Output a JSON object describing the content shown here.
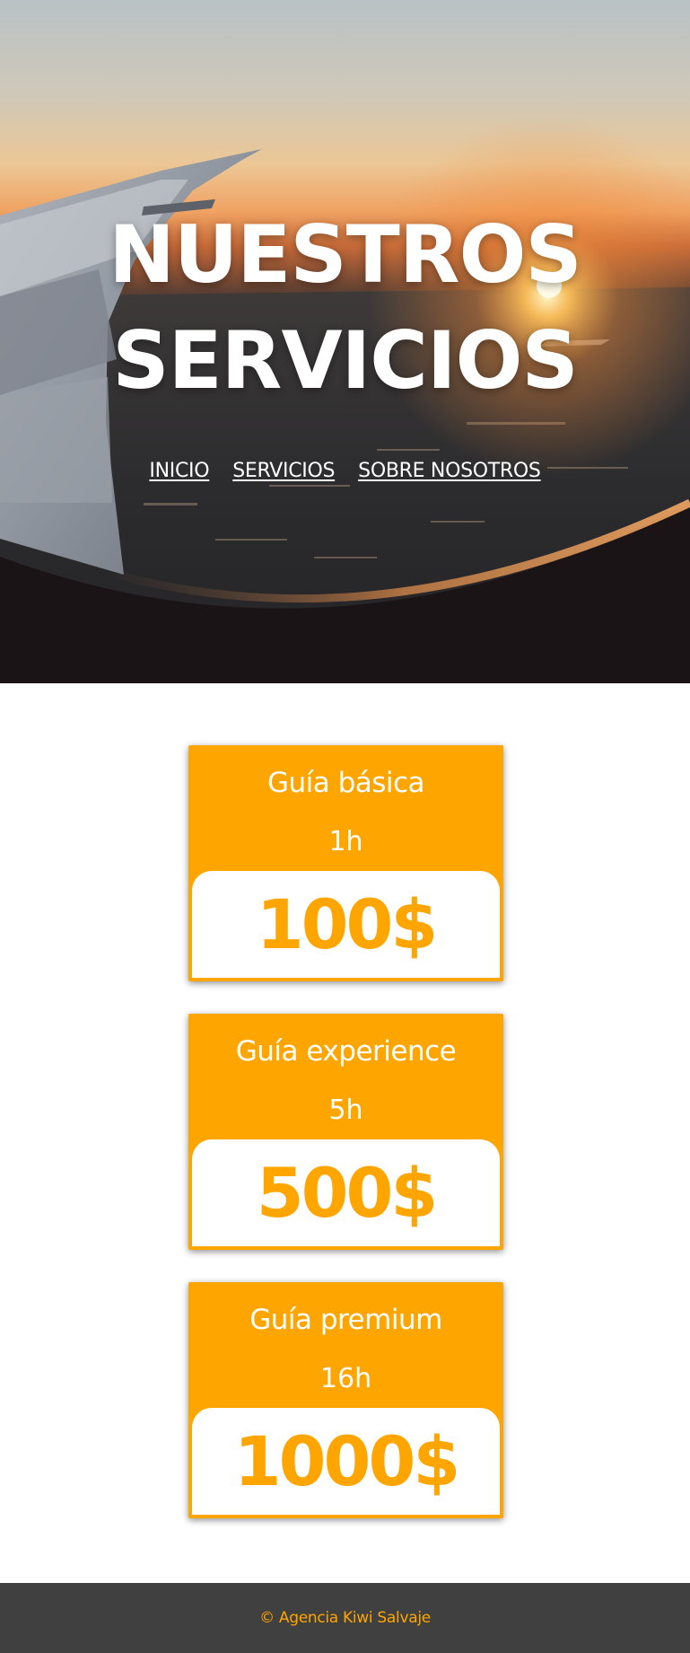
{
  "hero": {
    "title_line1": "NUESTROS",
    "title_line2": "SERVICIOS",
    "background_image": "airplane-wing-sunset-photo"
  },
  "nav": {
    "items": [
      {
        "label": "INICIO"
      },
      {
        "label": "SERVICIOS"
      },
      {
        "label": "SOBRE NOSOTROS"
      }
    ]
  },
  "services": [
    {
      "name": "Guía básica",
      "duration": "1h",
      "price": "100$"
    },
    {
      "name": "Guía experience",
      "duration": "5h",
      "price": "500$"
    },
    {
      "name": "Guía premium",
      "duration": "16h",
      "price": "1000$"
    }
  ],
  "footer": {
    "text": "© Agencia Kiwi Salvaje"
  },
  "colors": {
    "accent": "#ffa500",
    "footer_bg": "#404040",
    "text_light": "#ffffff"
  }
}
